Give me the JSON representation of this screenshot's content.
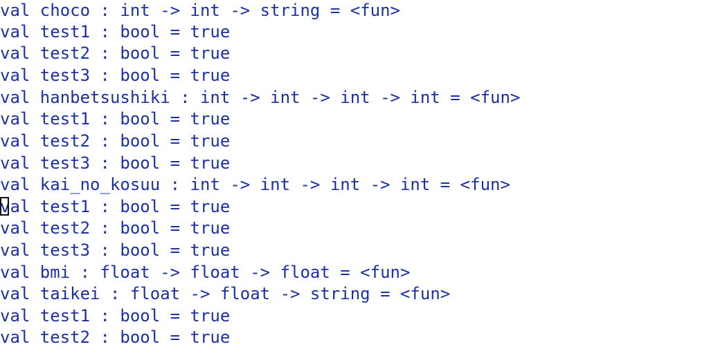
{
  "terminal": {
    "text_color": "#1b2fa6",
    "cursor_line_index": 9,
    "lines": [
      "val choco : int -> int -> string = <fun>",
      "val test1 : bool = true",
      "val test2 : bool = true",
      "val test3 : bool = true",
      "val hanbetsushiki : int -> int -> int -> int = <fun>",
      "val test1 : bool = true",
      "val test2 : bool = true",
      "val test3 : bool = true",
      "val kai_no_kosuu : int -> int -> int -> int = <fun>",
      "val test1 : bool = true",
      "val test2 : bool = true",
      "val test3 : bool = true",
      "val bmi : float -> float -> float = <fun>",
      "val taikei : float -> float -> string = <fun>",
      "val test1 : bool = true",
      "val test2 : bool = true"
    ]
  }
}
